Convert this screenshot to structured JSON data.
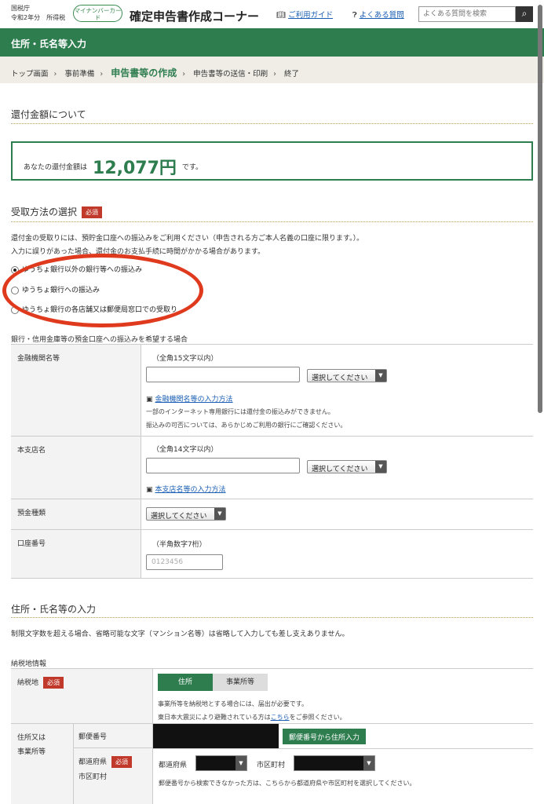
{
  "header": {
    "agency": "国税庁",
    "year_tax": "令和2年分　所得税",
    "mynumber_label": "マイナンバーカード",
    "app_title": "確定申告書作成コーナー",
    "guide_label": "ご利用ガイド",
    "faq_label": "よくある質問",
    "search_placeholder": "よくある質問を検索",
    "search_icon": "magnifier"
  },
  "page_title": "住所・氏名等入力",
  "breadcrumb": [
    "トップ画面",
    "事前準備",
    "申告書等の作成",
    "申告書等の送信・印刷",
    "終了"
  ],
  "breadcrumb_current_index": 2,
  "refund": {
    "section_title": "還付金額について",
    "prefix": "あなたの還付金額は",
    "amount": "12,077円",
    "suffix": "です。"
  },
  "receive": {
    "section_title": "受取方法の選択",
    "required": "必須",
    "description_1": "還付金の受取りには、預貯金口座への振込みをご利用ください（申告される方ご本人名義の口座に限ります。）。",
    "description_2": "入力に誤りがあった場合、還付金のお支払手続に時間がかかる場合があります。",
    "options": [
      {
        "label": "ゆうちょ銀行以外の銀行等への振込み",
        "selected": true
      },
      {
        "label": "ゆうちょ銀行への振込み",
        "selected": false
      },
      {
        "label": "ゆうちょ銀行の各店舗又は郵便局窓口での受取り",
        "selected": false
      }
    ]
  },
  "bank": {
    "caption": "銀行・信用金庫等の預金口座への振込みを希望する場合",
    "institution_label": "金融機関名等",
    "institution_hint": "（全角15文字以内）",
    "select_placeholder": "選択してください",
    "institution_link": "金融機関名等の入力方法",
    "institution_note_1": "一部のインターネット専用銀行には還付金の振込みができません。",
    "institution_note_2": "振込みの可否については、あらかじめご利用の銀行にご確認ください。",
    "branch_label": "本支店名",
    "branch_hint": "（全角14文字以内）",
    "branch_link": "本支店名等の入力方法",
    "deposit_type_label": "預金種類",
    "account_label": "口座番号",
    "account_hint": "（半角数字7桁）",
    "account_placeholder": "0123456"
  },
  "address": {
    "section_title": "住所・氏名等の入力",
    "description": "制限文字数を超える場合、省略可能な文字（マンション名等）は省略して入力しても差し支えありません。",
    "tax_place_caption": "納税地情報",
    "tax_place_label": "納税地",
    "required": "必須",
    "tab_home": "住所",
    "tab_office": "事業所等",
    "tax_note_1": "事業所等を納税地とする場合には、届出が必要です。",
    "tax_note_2_pre": "東日本大震災により避難されている方は",
    "tax_note_2_link": "こちら",
    "tax_note_2_post": "をご参照ください。",
    "addr_label_1": "住所又は",
    "addr_label_2": "事業所等",
    "postal_label": "郵便番号",
    "postal_button": "郵便番号から住所入力",
    "pref_label_1": "都道府県",
    "pref_label_2": "市区町村",
    "pref_field": "都道府県",
    "city_field": "市区町村",
    "pref_note": "郵便番号から検索できなかった方は、こちらから都道府県や市区町村を選択してください。"
  },
  "colors": {
    "brand_green": "#2e7d4f",
    "required_red": "#c0392b",
    "highlight_red": "#e03a1e",
    "link_blue": "#1a5fb4"
  }
}
